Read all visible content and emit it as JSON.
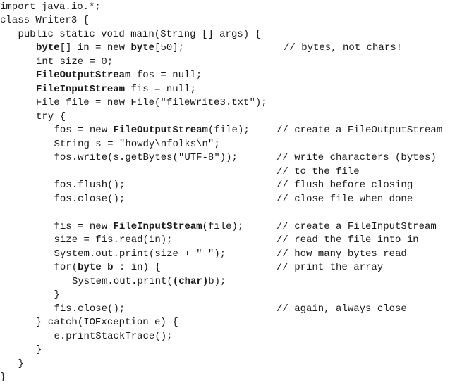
{
  "code_lines": [
    {
      "indent": 0,
      "code": [
        {
          "t": "import java.io.*;"
        }
      ],
      "comment": ""
    },
    {
      "indent": 0,
      "code": [
        {
          "t": "class Writer3 {"
        }
      ],
      "comment": ""
    },
    {
      "indent": 1,
      "code": [
        {
          "t": "public static void main(String [] args) {"
        }
      ],
      "comment": ""
    },
    {
      "indent": 2,
      "code": [
        {
          "t": "byte",
          "b": true
        },
        {
          "t": "[] in = new "
        },
        {
          "t": "byte",
          "b": true
        },
        {
          "t": "[50];"
        }
      ],
      "comment": "// bytes, not chars!"
    },
    {
      "indent": 2,
      "code": [
        {
          "t": "int size = 0;"
        }
      ],
      "comment": ""
    },
    {
      "indent": 2,
      "code": [
        {
          "t": "FileOutputStream",
          "b": true
        },
        {
          "t": " fos = null;"
        }
      ],
      "comment": ""
    },
    {
      "indent": 2,
      "code": [
        {
          "t": "FileInputStream",
          "b": true
        },
        {
          "t": " fis = null;"
        }
      ],
      "comment": ""
    },
    {
      "indent": 2,
      "code": [
        {
          "t": "File file = new File(\"fileWrite3.txt\");"
        }
      ],
      "comment": ""
    },
    {
      "indent": 2,
      "code": [
        {
          "t": "try {"
        }
      ],
      "comment": ""
    },
    {
      "indent": 3,
      "code": [
        {
          "t": "fos = new "
        },
        {
          "t": "FileOutputStream",
          "b": true
        },
        {
          "t": "(file);"
        }
      ],
      "comment": "// create a FileOutputStream"
    },
    {
      "indent": 3,
      "code": [
        {
          "t": "String s = \"howdy\\nfolks\\n\";"
        }
      ],
      "comment": ""
    },
    {
      "indent": 3,
      "code": [
        {
          "t": "fos.write(s.getBytes(\"UTF-8\"));"
        }
      ],
      "comment": "// write characters (bytes)"
    },
    {
      "indent": 3,
      "code": [],
      "comment": "// to the file"
    },
    {
      "indent": 3,
      "code": [
        {
          "t": "fos.flush();"
        }
      ],
      "comment": "// flush before closing"
    },
    {
      "indent": 3,
      "code": [
        {
          "t": "fos.close();"
        }
      ],
      "comment": "// close file when done"
    },
    {
      "indent": 0,
      "code": [],
      "comment": ""
    },
    {
      "indent": 3,
      "code": [
        {
          "t": "fis = new "
        },
        {
          "t": "FileInputStream",
          "b": true
        },
        {
          "t": "(file);"
        }
      ],
      "comment": "// create a FileInputStream"
    },
    {
      "indent": 3,
      "code": [
        {
          "t": "size = fis.read(in);"
        }
      ],
      "comment": "// read the file into in"
    },
    {
      "indent": 3,
      "code": [
        {
          "t": "System.out.print(size + \" \");"
        }
      ],
      "comment": "// how many bytes read"
    },
    {
      "indent": 3,
      "code": [
        {
          "t": "for("
        },
        {
          "t": "byte b",
          "b": true
        },
        {
          "t": " : in) {"
        }
      ],
      "comment": "// print the array"
    },
    {
      "indent": 4,
      "code": [
        {
          "t": "System.out.print("
        },
        {
          "t": "(char)",
          "b": true
        },
        {
          "t": "b);"
        }
      ],
      "comment": ""
    },
    {
      "indent": 3,
      "code": [
        {
          "t": "}"
        }
      ],
      "comment": ""
    },
    {
      "indent": 3,
      "code": [
        {
          "t": "fis.close();"
        }
      ],
      "comment": "// again, always close"
    },
    {
      "indent": 2,
      "code": [
        {
          "t": "} catch(IOException e) {"
        }
      ],
      "comment": ""
    },
    {
      "indent": 3,
      "code": [
        {
          "t": "e.printStackTrace();"
        }
      ],
      "comment": ""
    },
    {
      "indent": 2,
      "code": [
        {
          "t": "}"
        }
      ],
      "comment": ""
    },
    {
      "indent": 1,
      "code": [
        {
          "t": "}"
        }
      ],
      "comment": ""
    },
    {
      "indent": 0,
      "code": [
        {
          "t": "}"
        }
      ],
      "comment": ""
    }
  ]
}
